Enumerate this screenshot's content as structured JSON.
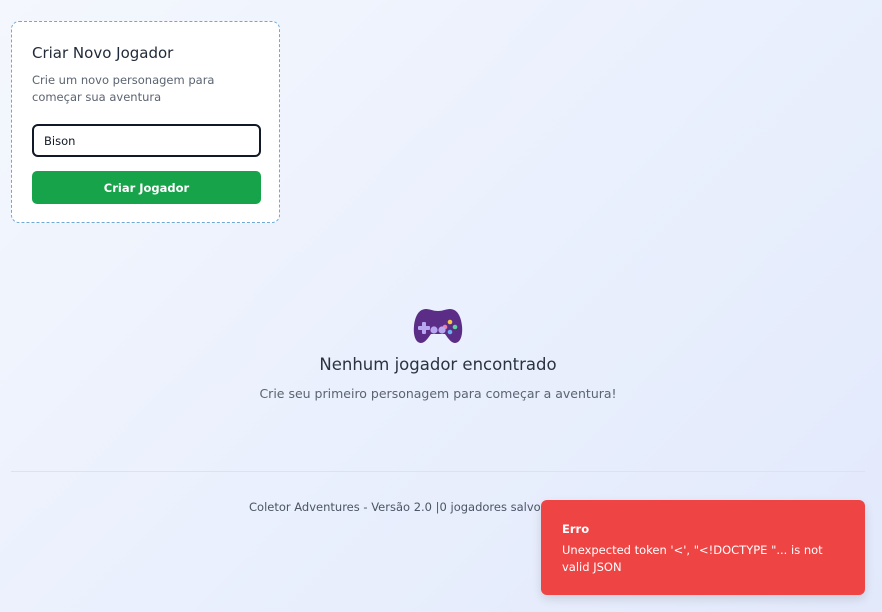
{
  "create_player": {
    "title": "Criar Novo Jogador",
    "subtitle": "Crie um novo personagem para começar sua aventura",
    "name_value": "Bison",
    "button_label": "Criar Jogador"
  },
  "empty_state": {
    "icon": "gamepad-icon",
    "title": "Nenhum jogador encontrado",
    "subtitle": "Crie seu primeiro personagem para começar a aventura!"
  },
  "footer": {
    "text": "Coletor Adventures - Versão 2.0 |0 jogadores salvos | Log"
  },
  "toast": {
    "title": "Erro",
    "message": "Unexpected token '<', \"<!DOCTYPE \"... is not valid JSON"
  },
  "colors": {
    "primary_button": "#16a34a",
    "error_toast": "#ef4444",
    "gamepad": "#5b2d86"
  }
}
